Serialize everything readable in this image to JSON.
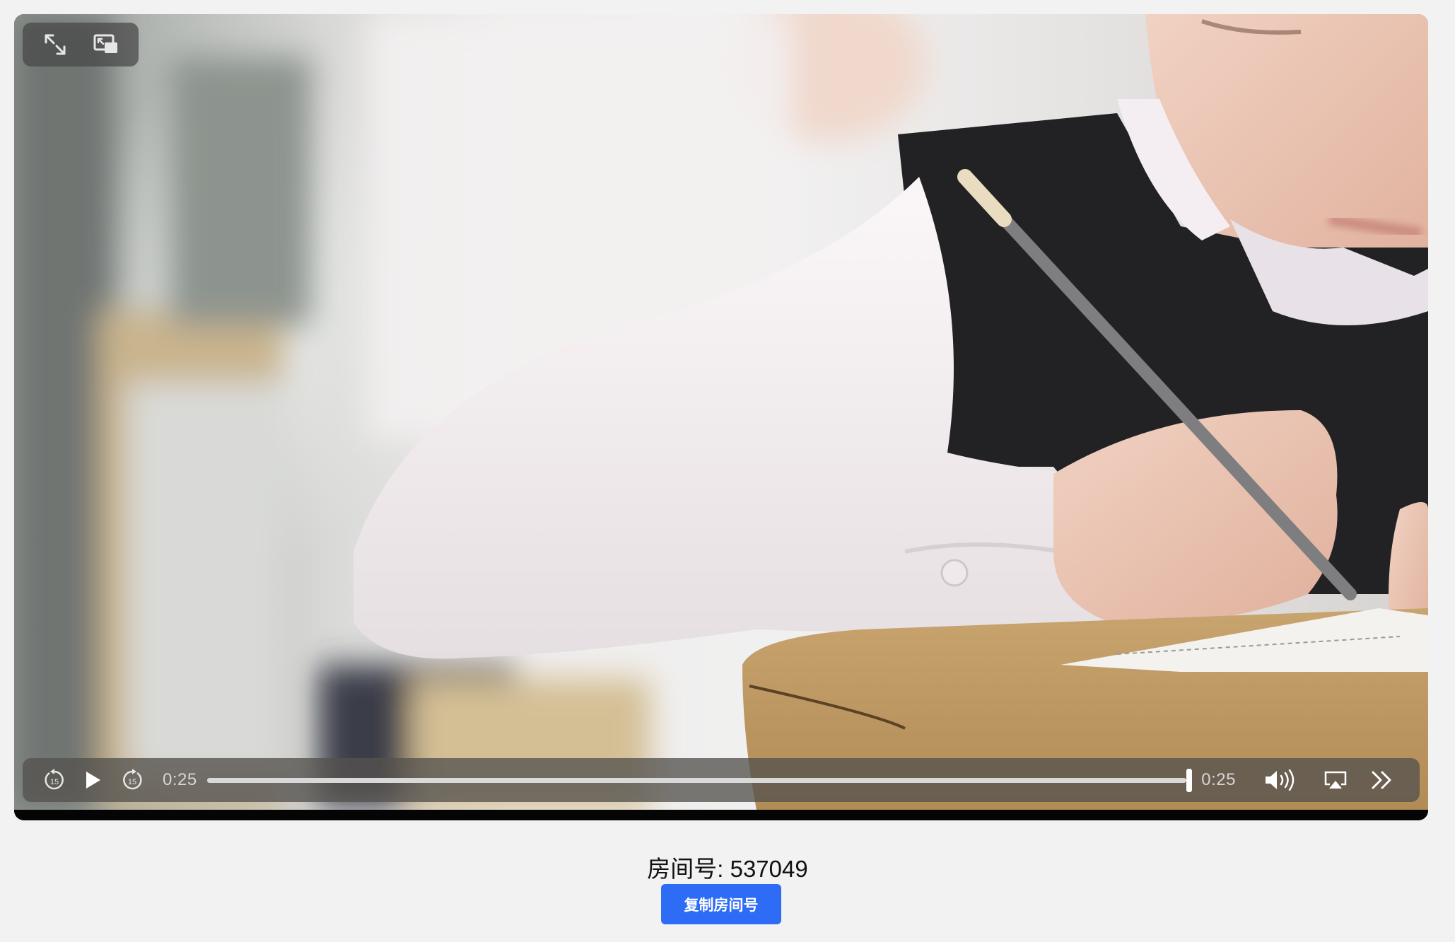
{
  "player": {
    "top_controls": [
      {
        "icon": "expand-arrows-icon"
      },
      {
        "icon": "picture-in-picture-icon"
      }
    ],
    "controls": {
      "skip_back_seconds": "15",
      "skip_forward_seconds": "15",
      "current_time": "0:25",
      "duration": "0:25",
      "progress": 1.0,
      "icons": {
        "skip_back": "skip-back-15-icon",
        "play": "play-icon",
        "skip_forward": "skip-forward-15-icon",
        "volume": "volume-icon",
        "airplay": "airplay-icon",
        "more": "more-chevron-icon"
      }
    }
  },
  "room": {
    "label": "房间号: 537049",
    "copy_button": "复制房间号"
  },
  "colors": {
    "page_background": "#f2f2f2",
    "accent": "#2f6cf6"
  }
}
